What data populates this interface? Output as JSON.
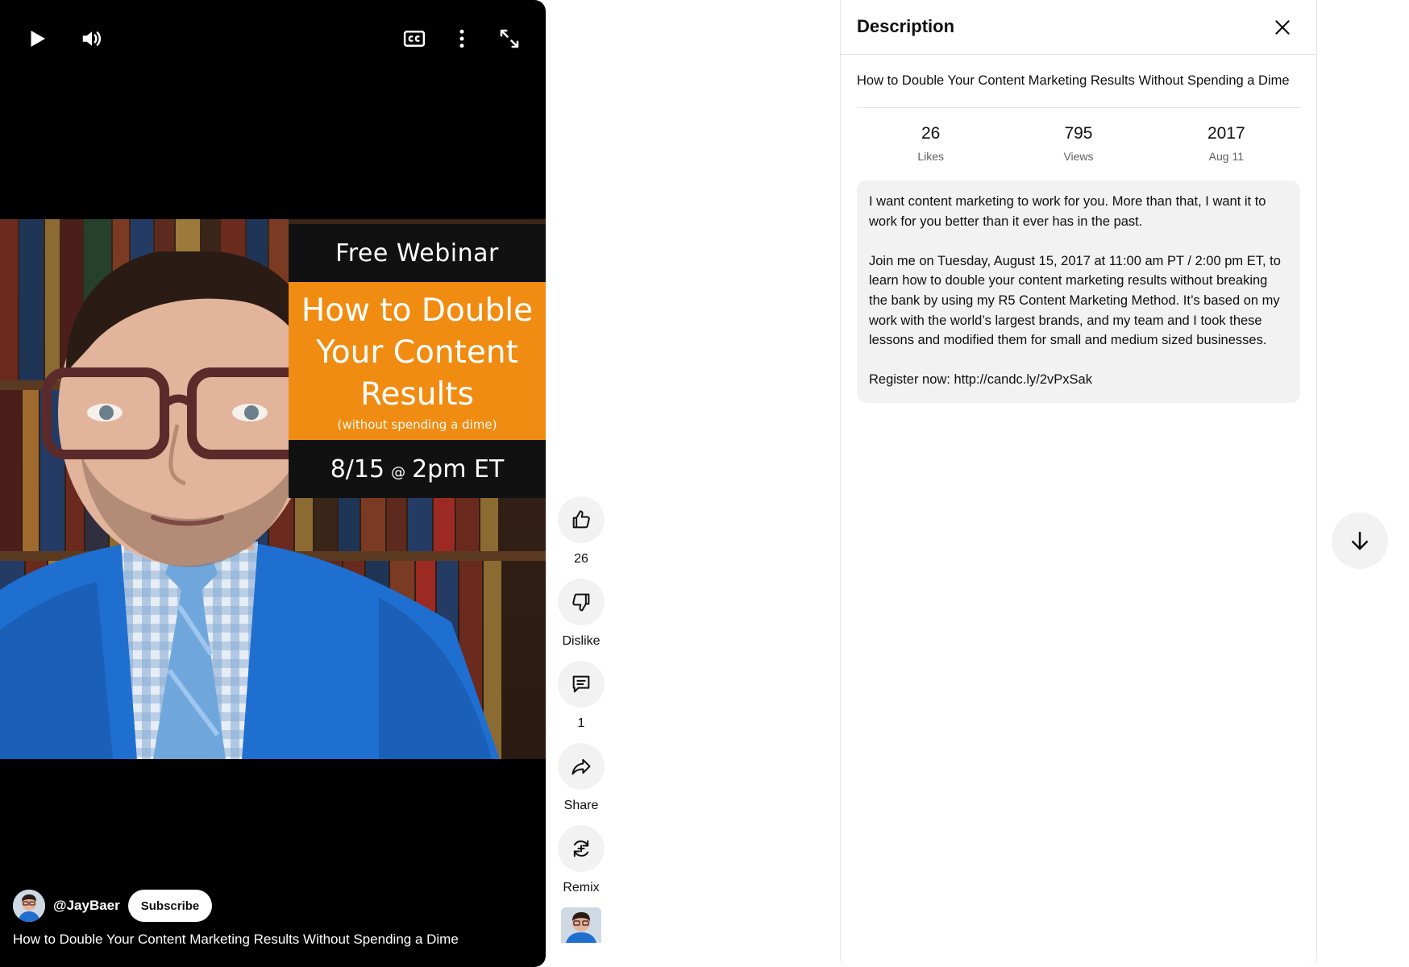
{
  "player": {
    "poster": {
      "header": "Free Webinar",
      "title_line1": "How to Double",
      "title_line2": "Your Content",
      "title_line3": "Results",
      "subtitle": "(without spending a dime)",
      "date": "8/15",
      "at": "@",
      "time": "2pm ET"
    },
    "channel": "@JayBaer",
    "subscribe_label": "Subscribe",
    "title": "How to Double Your Content Marketing Results Without Spending a Dime",
    "icons": [
      "play-icon",
      "volume-icon",
      "captions-icon",
      "more-vert-icon",
      "fullscreen-icon"
    ]
  },
  "actions": {
    "like": {
      "label": "26",
      "icon": "thumbs-up-icon"
    },
    "dislike": {
      "label": "Dislike",
      "icon": "thumbs-down-icon"
    },
    "comments": {
      "label": "1",
      "icon": "comment-icon"
    },
    "share": {
      "label": "Share",
      "icon": "share-icon"
    },
    "remix": {
      "label": "Remix",
      "icon": "remix-icon"
    }
  },
  "description": {
    "title": "Description",
    "headline": "How to Double Your Content Marketing Results Without Spending a Dime",
    "stats": [
      {
        "value": "26",
        "label": "Likes"
      },
      {
        "value": "795",
        "label": "Views"
      },
      {
        "value": "2017",
        "label": "Aug 11"
      }
    ],
    "paragraphs": [
      "I want content marketing to work for you. More than that, I want it to work for you better than it ever has in the past.",
      "Join me on Tuesday, August 15, 2017 at 11:00 am PT / 2:00 pm ET, to learn how to double your content marketing results without breaking the bank by using my R5 Content Marketing Method. It’s based on my work with the world’s largest brands, and my team and I took these lessons and  modified them for small and medium sized businesses.",
      "Register now: http://candc.ly/2vPxSak"
    ]
  },
  "colors": {
    "poster_orange": "#f08c12",
    "suit_blue": "#1f6fd1",
    "chip_gray": "#f2f2f2",
    "divider": "#e5e5e5"
  }
}
